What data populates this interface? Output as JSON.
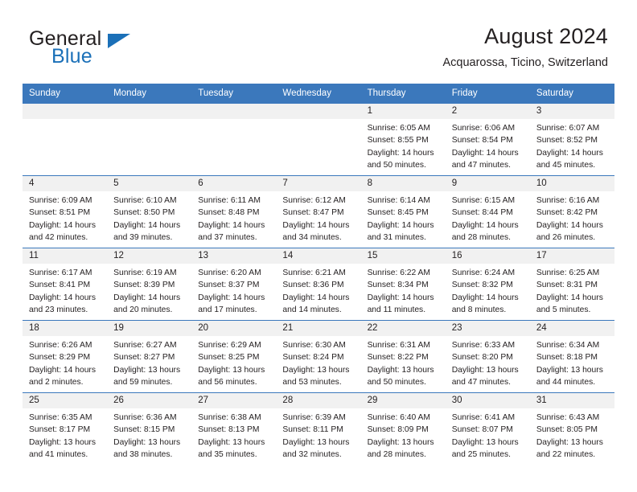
{
  "brand": {
    "name_part1": "General",
    "name_part2": "Blue",
    "triangle_color": "#1b70b8"
  },
  "header": {
    "title": "August 2024",
    "subtitle": "Acquarossa, Ticino, Switzerland"
  },
  "theme": {
    "header_blue": "#3b78bc",
    "daynum_band": "#f1f1f1",
    "text": "#231f20"
  },
  "calendar": {
    "weekday_headers": [
      "Sunday",
      "Monday",
      "Tuesday",
      "Wednesday",
      "Thursday",
      "Friday",
      "Saturday"
    ],
    "weeks": [
      [
        {
          "day": "",
          "sunrise": "",
          "sunset": "",
          "daylight_line1": "",
          "daylight_line2": ""
        },
        {
          "day": "",
          "sunrise": "",
          "sunset": "",
          "daylight_line1": "",
          "daylight_line2": ""
        },
        {
          "day": "",
          "sunrise": "",
          "sunset": "",
          "daylight_line1": "",
          "daylight_line2": ""
        },
        {
          "day": "",
          "sunrise": "",
          "sunset": "",
          "daylight_line1": "",
          "daylight_line2": ""
        },
        {
          "day": "1",
          "sunrise": "Sunrise: 6:05 AM",
          "sunset": "Sunset: 8:55 PM",
          "daylight_line1": "Daylight: 14 hours",
          "daylight_line2": "and 50 minutes."
        },
        {
          "day": "2",
          "sunrise": "Sunrise: 6:06 AM",
          "sunset": "Sunset: 8:54 PM",
          "daylight_line1": "Daylight: 14 hours",
          "daylight_line2": "and 47 minutes."
        },
        {
          "day": "3",
          "sunrise": "Sunrise: 6:07 AM",
          "sunset": "Sunset: 8:52 PM",
          "daylight_line1": "Daylight: 14 hours",
          "daylight_line2": "and 45 minutes."
        }
      ],
      [
        {
          "day": "4",
          "sunrise": "Sunrise: 6:09 AM",
          "sunset": "Sunset: 8:51 PM",
          "daylight_line1": "Daylight: 14 hours",
          "daylight_line2": "and 42 minutes."
        },
        {
          "day": "5",
          "sunrise": "Sunrise: 6:10 AM",
          "sunset": "Sunset: 8:50 PM",
          "daylight_line1": "Daylight: 14 hours",
          "daylight_line2": "and 39 minutes."
        },
        {
          "day": "6",
          "sunrise": "Sunrise: 6:11 AM",
          "sunset": "Sunset: 8:48 PM",
          "daylight_line1": "Daylight: 14 hours",
          "daylight_line2": "and 37 minutes."
        },
        {
          "day": "7",
          "sunrise": "Sunrise: 6:12 AM",
          "sunset": "Sunset: 8:47 PM",
          "daylight_line1": "Daylight: 14 hours",
          "daylight_line2": "and 34 minutes."
        },
        {
          "day": "8",
          "sunrise": "Sunrise: 6:14 AM",
          "sunset": "Sunset: 8:45 PM",
          "daylight_line1": "Daylight: 14 hours",
          "daylight_line2": "and 31 minutes."
        },
        {
          "day": "9",
          "sunrise": "Sunrise: 6:15 AM",
          "sunset": "Sunset: 8:44 PM",
          "daylight_line1": "Daylight: 14 hours",
          "daylight_line2": "and 28 minutes."
        },
        {
          "day": "10",
          "sunrise": "Sunrise: 6:16 AM",
          "sunset": "Sunset: 8:42 PM",
          "daylight_line1": "Daylight: 14 hours",
          "daylight_line2": "and 26 minutes."
        }
      ],
      [
        {
          "day": "11",
          "sunrise": "Sunrise: 6:17 AM",
          "sunset": "Sunset: 8:41 PM",
          "daylight_line1": "Daylight: 14 hours",
          "daylight_line2": "and 23 minutes."
        },
        {
          "day": "12",
          "sunrise": "Sunrise: 6:19 AM",
          "sunset": "Sunset: 8:39 PM",
          "daylight_line1": "Daylight: 14 hours",
          "daylight_line2": "and 20 minutes."
        },
        {
          "day": "13",
          "sunrise": "Sunrise: 6:20 AM",
          "sunset": "Sunset: 8:37 PM",
          "daylight_line1": "Daylight: 14 hours",
          "daylight_line2": "and 17 minutes."
        },
        {
          "day": "14",
          "sunrise": "Sunrise: 6:21 AM",
          "sunset": "Sunset: 8:36 PM",
          "daylight_line1": "Daylight: 14 hours",
          "daylight_line2": "and 14 minutes."
        },
        {
          "day": "15",
          "sunrise": "Sunrise: 6:22 AM",
          "sunset": "Sunset: 8:34 PM",
          "daylight_line1": "Daylight: 14 hours",
          "daylight_line2": "and 11 minutes."
        },
        {
          "day": "16",
          "sunrise": "Sunrise: 6:24 AM",
          "sunset": "Sunset: 8:32 PM",
          "daylight_line1": "Daylight: 14 hours",
          "daylight_line2": "and 8 minutes."
        },
        {
          "day": "17",
          "sunrise": "Sunrise: 6:25 AM",
          "sunset": "Sunset: 8:31 PM",
          "daylight_line1": "Daylight: 14 hours",
          "daylight_line2": "and 5 minutes."
        }
      ],
      [
        {
          "day": "18",
          "sunrise": "Sunrise: 6:26 AM",
          "sunset": "Sunset: 8:29 PM",
          "daylight_line1": "Daylight: 14 hours",
          "daylight_line2": "and 2 minutes."
        },
        {
          "day": "19",
          "sunrise": "Sunrise: 6:27 AM",
          "sunset": "Sunset: 8:27 PM",
          "daylight_line1": "Daylight: 13 hours",
          "daylight_line2": "and 59 minutes."
        },
        {
          "day": "20",
          "sunrise": "Sunrise: 6:29 AM",
          "sunset": "Sunset: 8:25 PM",
          "daylight_line1": "Daylight: 13 hours",
          "daylight_line2": "and 56 minutes."
        },
        {
          "day": "21",
          "sunrise": "Sunrise: 6:30 AM",
          "sunset": "Sunset: 8:24 PM",
          "daylight_line1": "Daylight: 13 hours",
          "daylight_line2": "and 53 minutes."
        },
        {
          "day": "22",
          "sunrise": "Sunrise: 6:31 AM",
          "sunset": "Sunset: 8:22 PM",
          "daylight_line1": "Daylight: 13 hours",
          "daylight_line2": "and 50 minutes."
        },
        {
          "day": "23",
          "sunrise": "Sunrise: 6:33 AM",
          "sunset": "Sunset: 8:20 PM",
          "daylight_line1": "Daylight: 13 hours",
          "daylight_line2": "and 47 minutes."
        },
        {
          "day": "24",
          "sunrise": "Sunrise: 6:34 AM",
          "sunset": "Sunset: 8:18 PM",
          "daylight_line1": "Daylight: 13 hours",
          "daylight_line2": "and 44 minutes."
        }
      ],
      [
        {
          "day": "25",
          "sunrise": "Sunrise: 6:35 AM",
          "sunset": "Sunset: 8:17 PM",
          "daylight_line1": "Daylight: 13 hours",
          "daylight_line2": "and 41 minutes."
        },
        {
          "day": "26",
          "sunrise": "Sunrise: 6:36 AM",
          "sunset": "Sunset: 8:15 PM",
          "daylight_line1": "Daylight: 13 hours",
          "daylight_line2": "and 38 minutes."
        },
        {
          "day": "27",
          "sunrise": "Sunrise: 6:38 AM",
          "sunset": "Sunset: 8:13 PM",
          "daylight_line1": "Daylight: 13 hours",
          "daylight_line2": "and 35 minutes."
        },
        {
          "day": "28",
          "sunrise": "Sunrise: 6:39 AM",
          "sunset": "Sunset: 8:11 PM",
          "daylight_line1": "Daylight: 13 hours",
          "daylight_line2": "and 32 minutes."
        },
        {
          "day": "29",
          "sunrise": "Sunrise: 6:40 AM",
          "sunset": "Sunset: 8:09 PM",
          "daylight_line1": "Daylight: 13 hours",
          "daylight_line2": "and 28 minutes."
        },
        {
          "day": "30",
          "sunrise": "Sunrise: 6:41 AM",
          "sunset": "Sunset: 8:07 PM",
          "daylight_line1": "Daylight: 13 hours",
          "daylight_line2": "and 25 minutes."
        },
        {
          "day": "31",
          "sunrise": "Sunrise: 6:43 AM",
          "sunset": "Sunset: 8:05 PM",
          "daylight_line1": "Daylight: 13 hours",
          "daylight_line2": "and 22 minutes."
        }
      ]
    ]
  }
}
